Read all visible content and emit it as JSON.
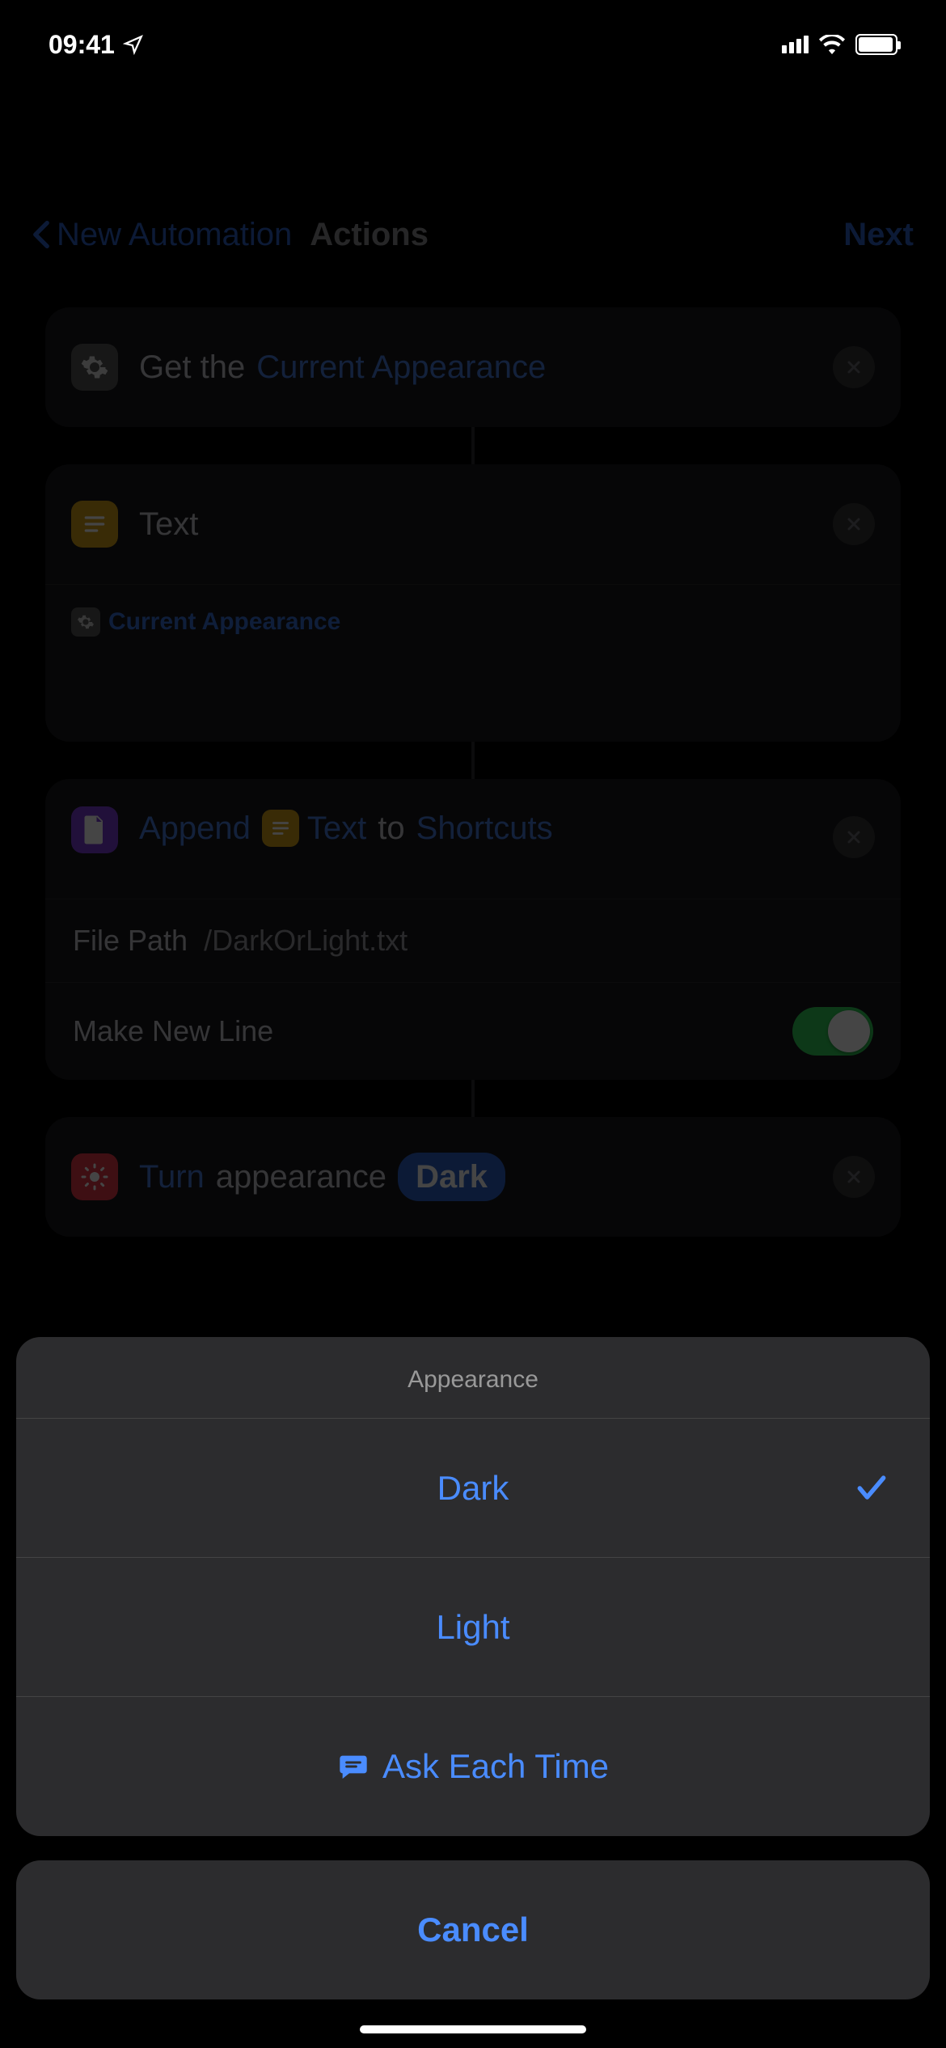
{
  "status": {
    "time": "09:41"
  },
  "nav": {
    "back": "New Automation",
    "title": "Actions",
    "next": "Next"
  },
  "actions": {
    "a1": {
      "prefix": "Get the",
      "param": "Current Appearance"
    },
    "a2": {
      "title": "Text",
      "chip": "Current Appearance"
    },
    "a3": {
      "word1": "Append",
      "word2": "Text",
      "word3": "to",
      "dest": "Shortcuts",
      "filepath_label": "File Path",
      "filepath_value": "/DarkOrLight.txt",
      "newline_label": "Make New Line"
    },
    "a4": {
      "word1": "Turn",
      "word2": "appearance",
      "pill": "Dark"
    }
  },
  "sheet": {
    "title": "Appearance",
    "opt1": "Dark",
    "opt2": "Light",
    "opt3": "Ask Each Time",
    "cancel": "Cancel"
  }
}
